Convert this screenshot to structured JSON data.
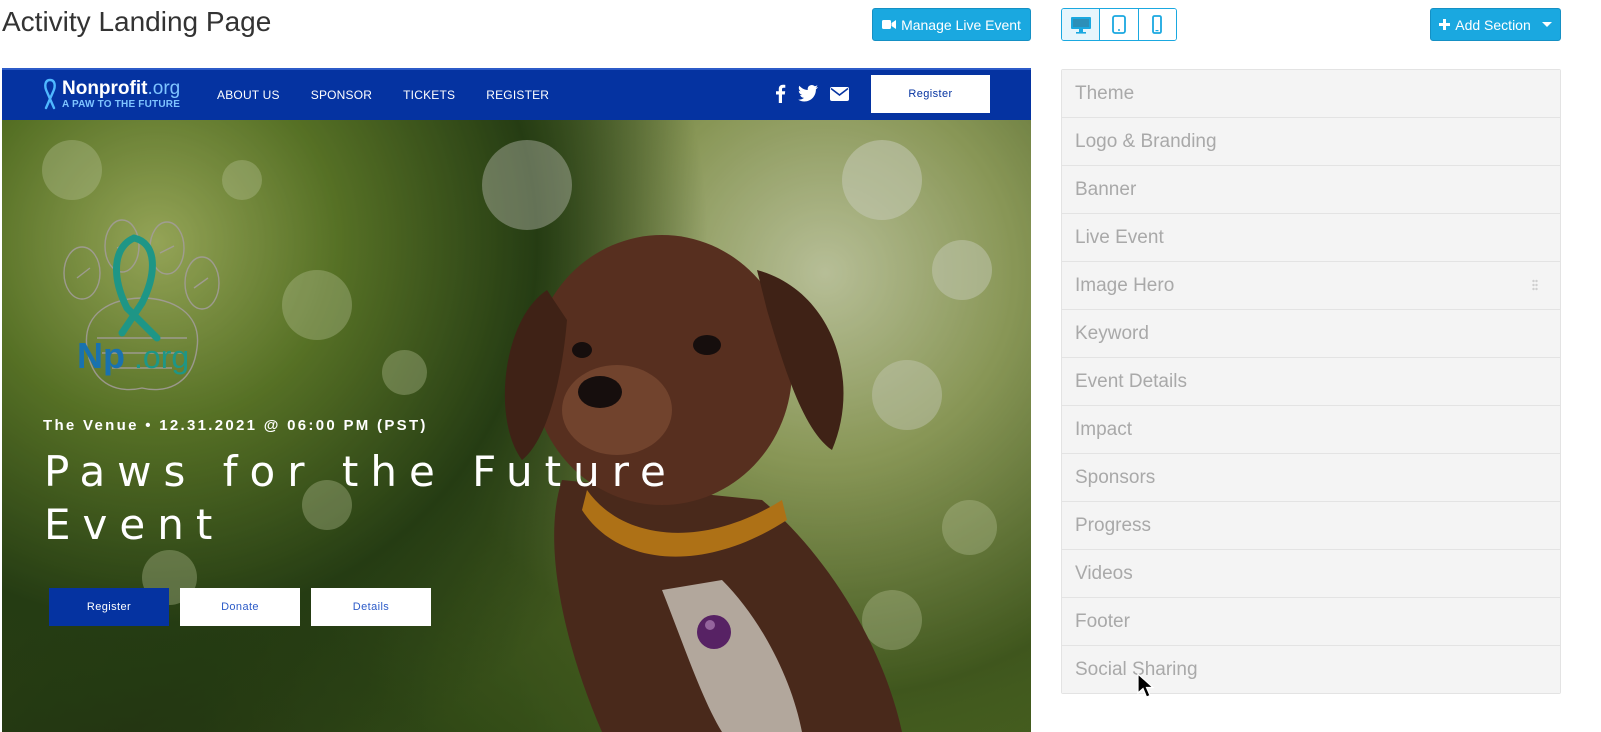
{
  "header": {
    "title": "Activity Landing Page",
    "manage_live_label": "Manage Live Event",
    "add_section_label": "Add Section",
    "device_buttons": [
      {
        "icon": "desktop-icon",
        "active": true
      },
      {
        "icon": "tablet-icon",
        "active": false
      },
      {
        "icon": "phone-icon",
        "active": false
      }
    ]
  },
  "site_nav": {
    "brand_name": "Nonprofit",
    "brand_tld": ".org",
    "brand_tagline": "A PAW TO THE FUTURE",
    "links": [
      "ABOUT US",
      "SPONSOR",
      "TICKETS",
      "REGISTER"
    ],
    "social_icons": [
      "facebook-icon",
      "twitter-icon",
      "email-icon"
    ],
    "register_label": "Register"
  },
  "hero": {
    "logo_text_np": "Np",
    "logo_text_org": ".org",
    "venue_line": "The Venue • 12.31.2021 @ 06:00 PM (PST)",
    "event_title": "Paws for the Future Event",
    "buttons": {
      "register": "Register",
      "donate": "Donate",
      "details": "Details"
    }
  },
  "sections": [
    {
      "label": "Theme"
    },
    {
      "label": "Logo & Branding"
    },
    {
      "label": "Banner"
    },
    {
      "label": "Live Event"
    },
    {
      "label": "Image Hero",
      "hovered": true
    },
    {
      "label": "Keyword"
    },
    {
      "label": "Event Details"
    },
    {
      "label": "Impact"
    },
    {
      "label": "Sponsors"
    },
    {
      "label": "Progress"
    },
    {
      "label": "Videos"
    },
    {
      "label": "Footer"
    },
    {
      "label": "Social Sharing"
    }
  ],
  "colors": {
    "accent": "#1aa8e0",
    "site_nav_bg": "#0533a1",
    "section_text": "#a9a9a9"
  }
}
